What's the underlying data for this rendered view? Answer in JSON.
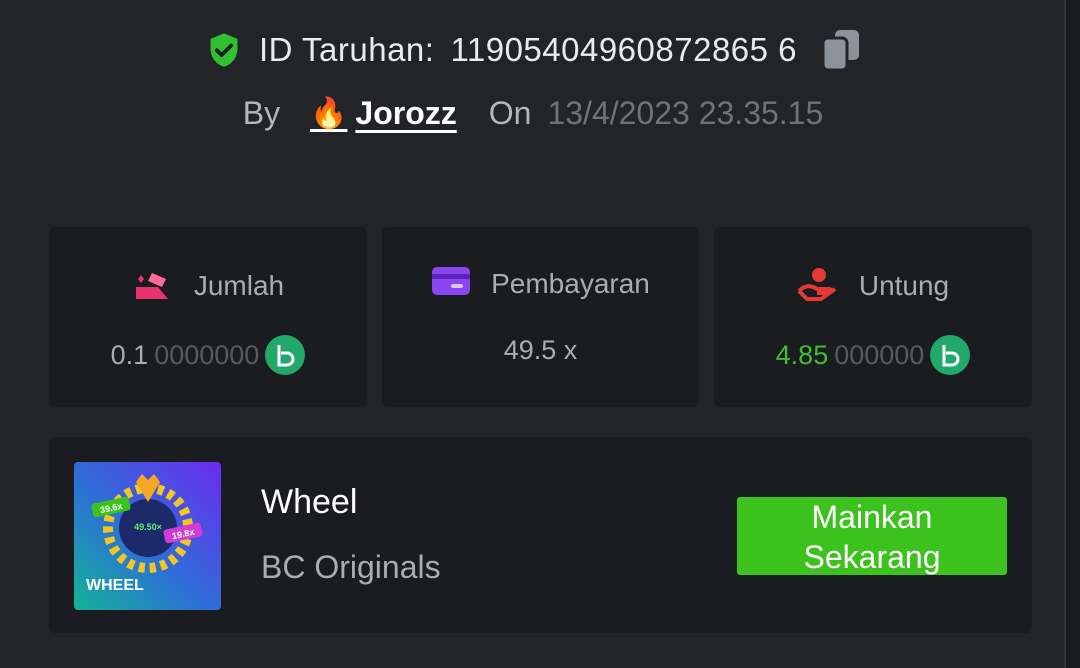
{
  "header": {
    "bet_id_label": "ID Taruhan:",
    "bet_id": "11905404960872865 6",
    "by_label": "By",
    "username": "Jorozz",
    "on_label": "On",
    "datetime": "13/4/2023 23.35.15"
  },
  "stats": {
    "amount": {
      "label": "Jumlah",
      "value_main": "0.1",
      "value_dim": "0000000"
    },
    "payout": {
      "label": "Pembayaran",
      "value": "49.5 x"
    },
    "profit": {
      "label": "Untung",
      "value_main": "4.85",
      "value_dim": "000000"
    }
  },
  "game": {
    "title": "Wheel",
    "provider": "BC Originals",
    "play_label_line1": "Mainkan",
    "play_label_line2": "Sekarang",
    "thumb": {
      "name": "WHEEL",
      "center": "49.50×",
      "left": "39.6x",
      "right": "19.8x"
    }
  },
  "colors": {
    "background": "#232428",
    "card": "#1b1c20",
    "accent_green": "#3cc21d",
    "profit_green": "#3fbf2b",
    "coin": "#21a86b",
    "amount_icon": "#e8336f",
    "payout_icon": "#8a45f0",
    "profit_icon": "#e53935"
  },
  "icons": {
    "verified": "shield-check-icon",
    "copy": "copy-icon",
    "fire": "fire-icon",
    "amount": "bet-amount-icon",
    "payout": "wallet-card-icon",
    "profit": "hand-coin-icon",
    "coin": "bc-coin-icon"
  }
}
